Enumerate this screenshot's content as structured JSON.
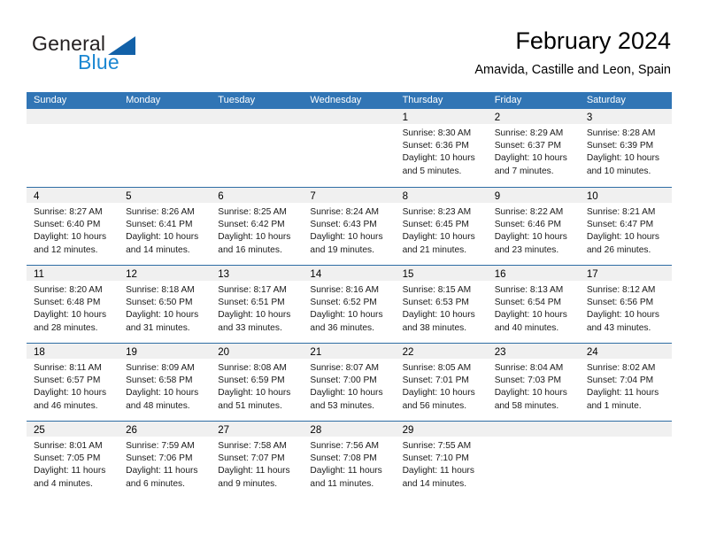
{
  "logo": {
    "word_one": "General",
    "word_two": "Blue",
    "flag_icon": "triangle-flag-icon",
    "brand_color": "#1b87d2",
    "flag_color": "#1261a8"
  },
  "header": {
    "title": "February 2024",
    "location": "Amavida, Castille and Leon, Spain"
  },
  "theme": {
    "header_blue": "#3175b5",
    "separator_blue": "#2e6da4",
    "day_band_gray": "#f0f0f0"
  },
  "calendar": {
    "day_names": [
      "Sunday",
      "Monday",
      "Tuesday",
      "Wednesday",
      "Thursday",
      "Friday",
      "Saturday"
    ],
    "weeks": [
      [
        {
          "day": "",
          "lines": []
        },
        {
          "day": "",
          "lines": []
        },
        {
          "day": "",
          "lines": []
        },
        {
          "day": "",
          "lines": []
        },
        {
          "day": "1",
          "lines": [
            "Sunrise: 8:30 AM",
            "Sunset: 6:36 PM",
            "Daylight: 10 hours",
            "and 5 minutes."
          ]
        },
        {
          "day": "2",
          "lines": [
            "Sunrise: 8:29 AM",
            "Sunset: 6:37 PM",
            "Daylight: 10 hours",
            "and 7 minutes."
          ]
        },
        {
          "day": "3",
          "lines": [
            "Sunrise: 8:28 AM",
            "Sunset: 6:39 PM",
            "Daylight: 10 hours",
            "and 10 minutes."
          ]
        }
      ],
      [
        {
          "day": "4",
          "lines": [
            "Sunrise: 8:27 AM",
            "Sunset: 6:40 PM",
            "Daylight: 10 hours",
            "and 12 minutes."
          ]
        },
        {
          "day": "5",
          "lines": [
            "Sunrise: 8:26 AM",
            "Sunset: 6:41 PM",
            "Daylight: 10 hours",
            "and 14 minutes."
          ]
        },
        {
          "day": "6",
          "lines": [
            "Sunrise: 8:25 AM",
            "Sunset: 6:42 PM",
            "Daylight: 10 hours",
            "and 16 minutes."
          ]
        },
        {
          "day": "7",
          "lines": [
            "Sunrise: 8:24 AM",
            "Sunset: 6:43 PM",
            "Daylight: 10 hours",
            "and 19 minutes."
          ]
        },
        {
          "day": "8",
          "lines": [
            "Sunrise: 8:23 AM",
            "Sunset: 6:45 PM",
            "Daylight: 10 hours",
            "and 21 minutes."
          ]
        },
        {
          "day": "9",
          "lines": [
            "Sunrise: 8:22 AM",
            "Sunset: 6:46 PM",
            "Daylight: 10 hours",
            "and 23 minutes."
          ]
        },
        {
          "day": "10",
          "lines": [
            "Sunrise: 8:21 AM",
            "Sunset: 6:47 PM",
            "Daylight: 10 hours",
            "and 26 minutes."
          ]
        }
      ],
      [
        {
          "day": "11",
          "lines": [
            "Sunrise: 8:20 AM",
            "Sunset: 6:48 PM",
            "Daylight: 10 hours",
            "and 28 minutes."
          ]
        },
        {
          "day": "12",
          "lines": [
            "Sunrise: 8:18 AM",
            "Sunset: 6:50 PM",
            "Daylight: 10 hours",
            "and 31 minutes."
          ]
        },
        {
          "day": "13",
          "lines": [
            "Sunrise: 8:17 AM",
            "Sunset: 6:51 PM",
            "Daylight: 10 hours",
            "and 33 minutes."
          ]
        },
        {
          "day": "14",
          "lines": [
            "Sunrise: 8:16 AM",
            "Sunset: 6:52 PM",
            "Daylight: 10 hours",
            "and 36 minutes."
          ]
        },
        {
          "day": "15",
          "lines": [
            "Sunrise: 8:15 AM",
            "Sunset: 6:53 PM",
            "Daylight: 10 hours",
            "and 38 minutes."
          ]
        },
        {
          "day": "16",
          "lines": [
            "Sunrise: 8:13 AM",
            "Sunset: 6:54 PM",
            "Daylight: 10 hours",
            "and 40 minutes."
          ]
        },
        {
          "day": "17",
          "lines": [
            "Sunrise: 8:12 AM",
            "Sunset: 6:56 PM",
            "Daylight: 10 hours",
            "and 43 minutes."
          ]
        }
      ],
      [
        {
          "day": "18",
          "lines": [
            "Sunrise: 8:11 AM",
            "Sunset: 6:57 PM",
            "Daylight: 10 hours",
            "and 46 minutes."
          ]
        },
        {
          "day": "19",
          "lines": [
            "Sunrise: 8:09 AM",
            "Sunset: 6:58 PM",
            "Daylight: 10 hours",
            "and 48 minutes."
          ]
        },
        {
          "day": "20",
          "lines": [
            "Sunrise: 8:08 AM",
            "Sunset: 6:59 PM",
            "Daylight: 10 hours",
            "and 51 minutes."
          ]
        },
        {
          "day": "21",
          "lines": [
            "Sunrise: 8:07 AM",
            "Sunset: 7:00 PM",
            "Daylight: 10 hours",
            "and 53 minutes."
          ]
        },
        {
          "day": "22",
          "lines": [
            "Sunrise: 8:05 AM",
            "Sunset: 7:01 PM",
            "Daylight: 10 hours",
            "and 56 minutes."
          ]
        },
        {
          "day": "23",
          "lines": [
            "Sunrise: 8:04 AM",
            "Sunset: 7:03 PM",
            "Daylight: 10 hours",
            "and 58 minutes."
          ]
        },
        {
          "day": "24",
          "lines": [
            "Sunrise: 8:02 AM",
            "Sunset: 7:04 PM",
            "Daylight: 11 hours",
            "and 1 minute."
          ]
        }
      ],
      [
        {
          "day": "25",
          "lines": [
            "Sunrise: 8:01 AM",
            "Sunset: 7:05 PM",
            "Daylight: 11 hours",
            "and 4 minutes."
          ]
        },
        {
          "day": "26",
          "lines": [
            "Sunrise: 7:59 AM",
            "Sunset: 7:06 PM",
            "Daylight: 11 hours",
            "and 6 minutes."
          ]
        },
        {
          "day": "27",
          "lines": [
            "Sunrise: 7:58 AM",
            "Sunset: 7:07 PM",
            "Daylight: 11 hours",
            "and 9 minutes."
          ]
        },
        {
          "day": "28",
          "lines": [
            "Sunrise: 7:56 AM",
            "Sunset: 7:08 PM",
            "Daylight: 11 hours",
            "and 11 minutes."
          ]
        },
        {
          "day": "29",
          "lines": [
            "Sunrise: 7:55 AM",
            "Sunset: 7:10 PM",
            "Daylight: 11 hours",
            "and 14 minutes."
          ]
        },
        {
          "day": "",
          "lines": []
        },
        {
          "day": "",
          "lines": []
        }
      ]
    ]
  }
}
